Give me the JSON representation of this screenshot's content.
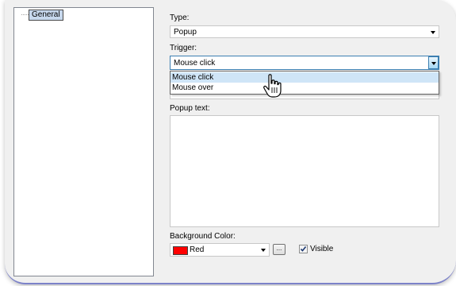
{
  "tree": {
    "nodes": [
      {
        "label": "General"
      }
    ]
  },
  "form": {
    "type": {
      "label": "Type:",
      "value": "Popup"
    },
    "trigger": {
      "label": "Trigger:",
      "value": "Mouse click",
      "options": [
        "Mouse click",
        "Mouse over"
      ],
      "highlighted_option": "Mouse click"
    },
    "popup_text": {
      "label": "Popup text:",
      "value": ""
    },
    "background_color": {
      "label": "Background Color:",
      "value": "Red",
      "swatch_color": "#ff0000",
      "browse_label": "..."
    },
    "visible": {
      "label": "Visible",
      "checked": true
    }
  },
  "colors": {
    "frame_background": "#f0f0f0",
    "selection": "#cfe5f7",
    "accent_border": "#3c7fb1"
  },
  "cursor": {
    "icon": "hand-pointer-icon"
  }
}
